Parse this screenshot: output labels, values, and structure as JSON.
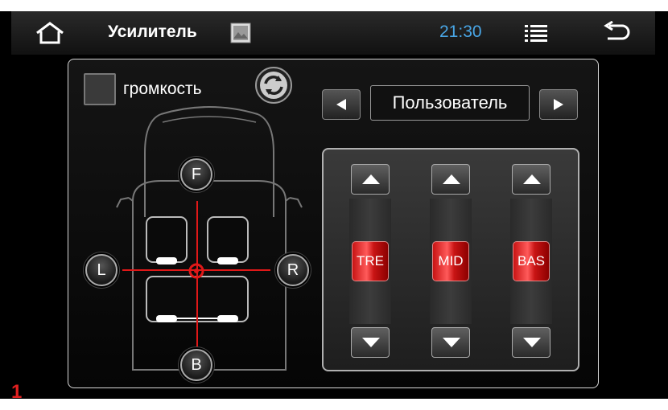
{
  "topbar": {
    "title": "Усилитель",
    "clock": "21:30",
    "icons": [
      "home-icon",
      "image-icon",
      "list-icon",
      "back-icon"
    ],
    "clock_color": "#49a6e6"
  },
  "balance": {
    "volume_label": "громкость",
    "front_label": "F",
    "back_label": "B",
    "left_label": "L",
    "right_label": "R"
  },
  "preset": {
    "name": "Пользователь"
  },
  "equalizer": {
    "bands": [
      {
        "label": "TRE"
      },
      {
        "label": "MID"
      },
      {
        "label": "BAS"
      }
    ],
    "knob_color": "#d01818"
  },
  "corner_mark": "1"
}
